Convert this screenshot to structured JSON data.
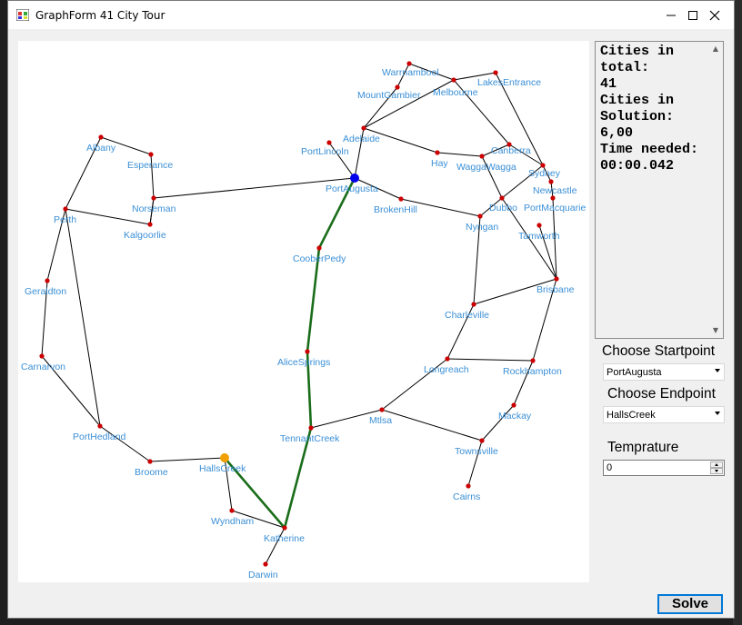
{
  "window": {
    "title": "GraphForm 41 City Tour"
  },
  "info": {
    "label_total": "Cities in total:",
    "total": "41",
    "label_solution": "Cities in Solution:",
    "solution": "6,00",
    "label_time": "Time needed:",
    "time": "00:00.042"
  },
  "controls": {
    "start_label": "Choose Startpoint",
    "start_value": "PortAugusta",
    "end_label": "Choose Endpoint",
    "end_value": "HallsCreek",
    "temp_label": "Temprature",
    "temp_value": "0",
    "solve_label": "Solve"
  },
  "colors": {
    "edge": "#000000",
    "path": "#1a6d1a",
    "node": "#cc0000",
    "start_node": "#0000ee",
    "end_node": "#f0a000",
    "label": "#3a8fd6"
  },
  "graph": {
    "cities": [
      {
        "name": "Warrnambool"
      },
      {
        "name": "Melbourne"
      },
      {
        "name": "LakesEntrance"
      },
      {
        "name": "MountGambier"
      },
      {
        "name": "Adelaide"
      },
      {
        "name": "PortLincoln"
      },
      {
        "name": "PortAugusta"
      },
      {
        "name": "Albany"
      },
      {
        "name": "Esperance"
      },
      {
        "name": "Norseman"
      },
      {
        "name": "Kalgoorlie"
      },
      {
        "name": "Perth"
      },
      {
        "name": "Hay"
      },
      {
        "name": "Canberra"
      },
      {
        "name": "WaggaWagga"
      },
      {
        "name": "Sydney"
      },
      {
        "name": "Newcastle"
      },
      {
        "name": "Dubbo"
      },
      {
        "name": "PortMacquarie"
      },
      {
        "name": "Tamworth"
      },
      {
        "name": "BrokenHill"
      },
      {
        "name": "Nyngan"
      },
      {
        "name": "CooberPedy"
      },
      {
        "name": "Geraldton"
      },
      {
        "name": "Brisbane"
      },
      {
        "name": "Charleville"
      },
      {
        "name": "Carnarvon"
      },
      {
        "name": "AliceSprings"
      },
      {
        "name": "Longreach"
      },
      {
        "name": "Rockhampton"
      },
      {
        "name": "Mackay"
      },
      {
        "name": "Mtlsa"
      },
      {
        "name": "TennantCreek"
      },
      {
        "name": "PortHedland"
      },
      {
        "name": "Townsville"
      },
      {
        "name": "Broome"
      },
      {
        "name": "HallsCreek"
      },
      {
        "name": "Cairns"
      },
      {
        "name": "Wyndham"
      },
      {
        "name": "Katherine"
      },
      {
        "name": "Darwin"
      }
    ],
    "edges": [
      [
        "Warrnambool",
        "Melbourne"
      ],
      [
        "Warrnambool",
        "MountGambier"
      ],
      [
        "MountGambier",
        "Adelaide"
      ],
      [
        "Adelaide",
        "Melbourne"
      ],
      [
        "Melbourne",
        "LakesEntrance"
      ],
      [
        "LakesEntrance",
        "Sydney"
      ],
      [
        "Melbourne",
        "Canberra"
      ],
      [
        "Adelaide",
        "Hay"
      ],
      [
        "Hay",
        "WaggaWagga"
      ],
      [
        "Adelaide",
        "PortAugusta"
      ],
      [
        "PortLincoln",
        "PortAugusta"
      ],
      [
        "PortAugusta",
        "BrokenHill"
      ],
      [
        "PortAugusta",
        "Norseman"
      ],
      [
        "BrokenHill",
        "Nyngan"
      ],
      [
        "Nyngan",
        "Dubbo"
      ],
      [
        "Dubbo",
        "WaggaWagga"
      ],
      [
        "WaggaWagga",
        "Canberra"
      ],
      [
        "Canberra",
        "Sydney"
      ],
      [
        "Sydney",
        "Newcastle"
      ],
      [
        "Sydney",
        "Dubbo"
      ],
      [
        "Newcastle",
        "PortMacquarie"
      ],
      [
        "PortMacquarie",
        "Brisbane"
      ],
      [
        "Tamworth",
        "Brisbane"
      ],
      [
        "Dubbo",
        "Brisbane"
      ],
      [
        "Nyngan",
        "Charleville"
      ],
      [
        "Charleville",
        "Brisbane"
      ],
      [
        "Charleville",
        "Longreach"
      ],
      [
        "Longreach",
        "Rockhampton"
      ],
      [
        "Rockhampton",
        "Brisbane"
      ],
      [
        "Rockhampton",
        "Mackay"
      ],
      [
        "Mackay",
        "Townsville"
      ],
      [
        "Longreach",
        "Mtlsa"
      ],
      [
        "Mtlsa",
        "Townsville"
      ],
      [
        "Townsville",
        "Cairns"
      ],
      [
        "Mtlsa",
        "TennantCreek"
      ],
      [
        "Albany",
        "Esperance"
      ],
      [
        "Esperance",
        "Norseman"
      ],
      [
        "Norseman",
        "Kalgoorlie"
      ],
      [
        "Kalgoorlie",
        "Perth"
      ],
      [
        "Kalgoorlie",
        "Norseman"
      ],
      [
        "Albany",
        "Perth"
      ],
      [
        "Perth",
        "Geraldton"
      ],
      [
        "Perth",
        "PortHedland"
      ],
      [
        "Geraldton",
        "Carnarvon"
      ],
      [
        "Carnarvon",
        "PortHedland"
      ],
      [
        "PortHedland",
        "Broome"
      ],
      [
        "Broome",
        "HallsCreek"
      ],
      [
        "HallsCreek",
        "Wyndham"
      ],
      [
        "Wyndham",
        "Katherine"
      ],
      [
        "Katherine",
        "Darwin"
      ]
    ],
    "path": [
      "PortAugusta",
      "CooberPedy",
      "AliceSprings",
      "TennantCreek",
      "Katherine",
      "HallsCreek"
    ],
    "start": "PortAugusta",
    "end": "HallsCreek"
  }
}
